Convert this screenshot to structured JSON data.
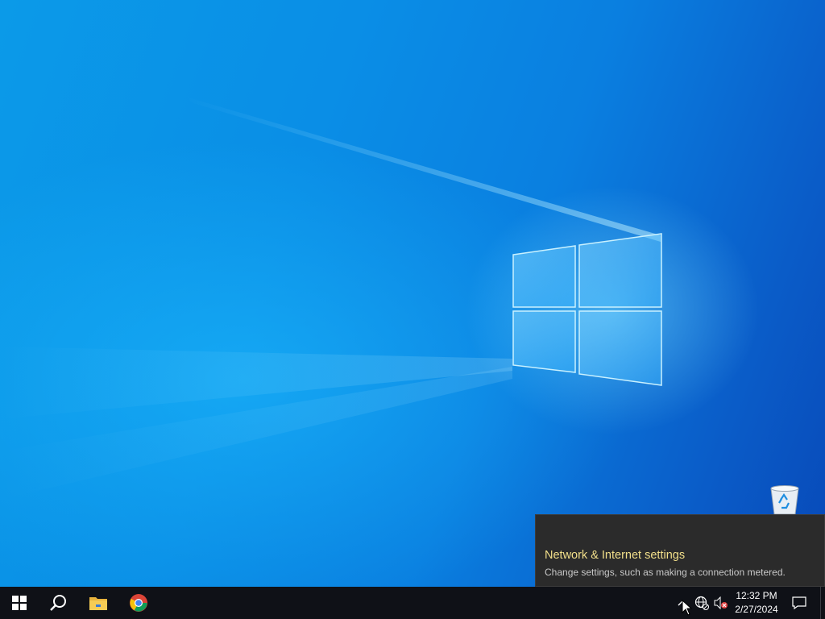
{
  "taskbar": {
    "apps": [
      {
        "name": "Start",
        "icon": "windows-logo-icon"
      },
      {
        "name": "Search",
        "icon": "search-icon"
      },
      {
        "name": "File Explorer",
        "icon": "folder-icon"
      },
      {
        "name": "Google Chrome",
        "icon": "chrome-icon"
      }
    ],
    "tray": {
      "chevron_icon": "chevron-up-icon",
      "network_icon": "globe-network-icon",
      "volume_icon": "volume-muted-icon",
      "time": "12:32 PM",
      "date": "2/27/2024",
      "notification_icon": "action-center-icon"
    }
  },
  "desktop": {
    "icons": [
      {
        "name": "Recycle Bin",
        "icon": "recycle-bin-icon"
      }
    ]
  },
  "tooltip": {
    "title": "Network & Internet settings",
    "description": "Change settings, such as making a connection metered."
  },
  "colors": {
    "taskbar": "#0f1117",
    "tooltip_bg": "#2b2b2b",
    "tooltip_title": "#f2df8a",
    "wallpaper_primary": "#0a8ee6"
  }
}
